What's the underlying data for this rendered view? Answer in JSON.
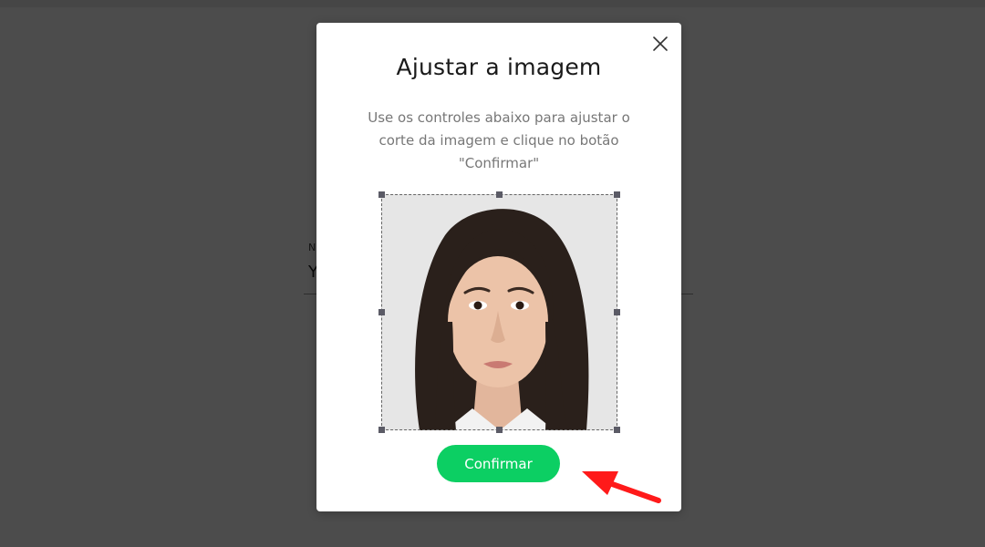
{
  "background": {
    "field_label": "N",
    "field_value": "Y"
  },
  "modal": {
    "title": "Ajustar a imagem",
    "description": "Use os controles abaixo para ajustar o corte da imagem e clique no botão \"Confirmar\"",
    "confirm_label": "Confirmar",
    "close_icon": "close-icon"
  },
  "colors": {
    "overlay": "#4a4a4a",
    "confirm_button": "#0ccf63",
    "annotation_arrow": "#ff1a1a",
    "crop_handle": "#5b5b66"
  },
  "cropper": {
    "image": "portrait-photo"
  },
  "annotation": {
    "icon": "red-arrow-icon"
  }
}
